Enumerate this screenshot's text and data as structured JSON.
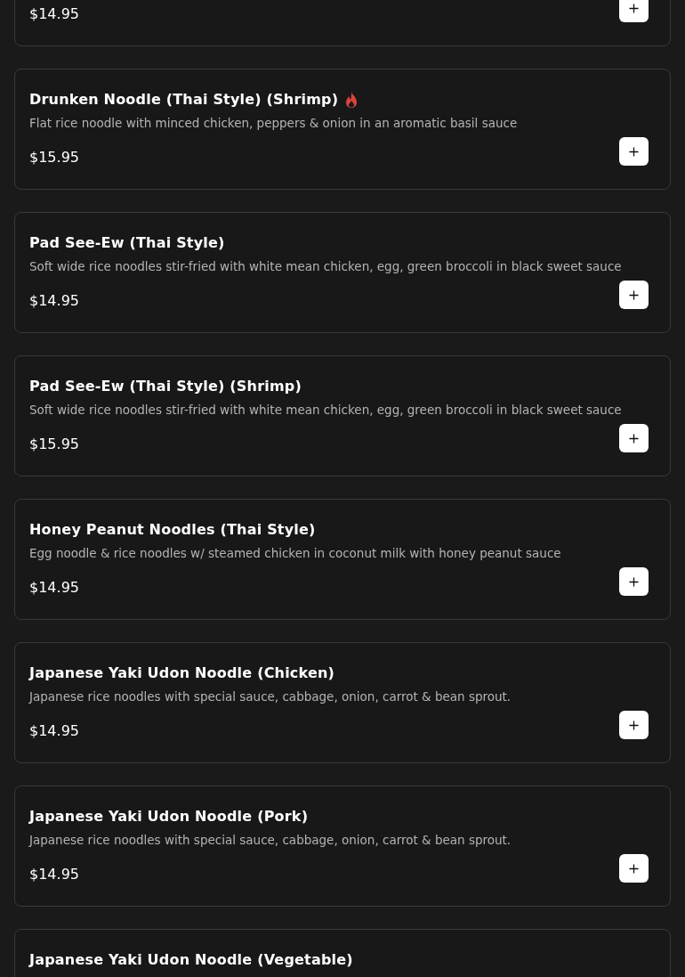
{
  "menu_items": [
    {
      "price": "$14.95"
    },
    {
      "name": "Drunken Noodle (Thai Style) (Shrimp)",
      "spicy": true,
      "description": "Flat rice noodle with minced chicken, peppers & onion in an aromatic basil sauce",
      "price": "$15.95"
    },
    {
      "name": "Pad See-Ew (Thai Style)",
      "spicy": false,
      "description": "Soft wide rice noodles stir-fried with white mean chicken, egg, green broccoli in black sweet sauce",
      "price": "$14.95"
    },
    {
      "name": "Pad See-Ew (Thai Style) (Shrimp)",
      "spicy": false,
      "description": "Soft wide rice noodles stir-fried with white mean chicken, egg, green broccoli in black sweet sauce",
      "price": "$15.95"
    },
    {
      "name": "Honey Peanut Noodles (Thai Style)",
      "spicy": false,
      "description": "Egg noodle & rice noodles w/ steamed chicken in coconut milk with honey peanut sauce",
      "price": "$14.95"
    },
    {
      "name": "Japanese Yaki Udon Noodle (Chicken)",
      "spicy": false,
      "description": "Japanese rice noodles with special sauce, cabbage, onion, carrot & bean sprout.",
      "price": "$14.95"
    },
    {
      "name": "Japanese Yaki Udon Noodle (Pork)",
      "spicy": false,
      "description": "Japanese rice noodles with special sauce, cabbage, onion, carrot & bean sprout.",
      "price": "$14.95"
    },
    {
      "name": "Japanese Yaki Udon Noodle (Vegetable)",
      "spicy": false
    }
  ]
}
